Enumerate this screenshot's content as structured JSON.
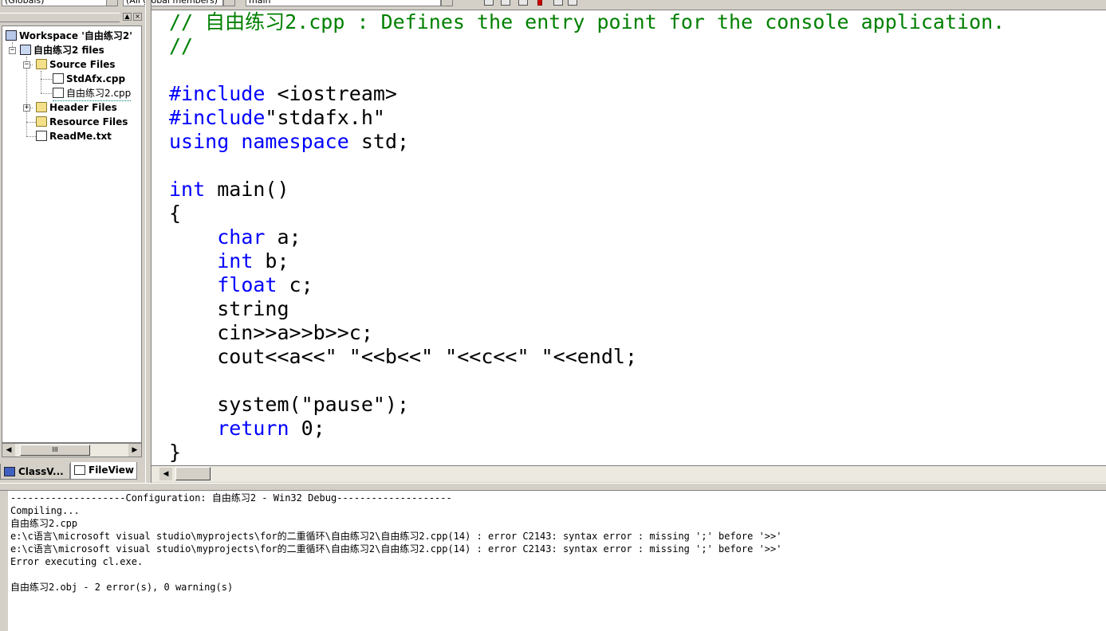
{
  "toolbar": {
    "scope_combo": "(Globals)",
    "members_combo": "(All global members)",
    "function_combo": "main"
  },
  "workspace": {
    "tree": {
      "workspace_label": "Workspace '自由练习2'",
      "project_label": "自由练习2 files",
      "source_files_label": "Source Files",
      "stdafx_label": "StdAfx.cpp",
      "main_file_label": "自由练习2.cpp",
      "header_files_label": "Header Files",
      "resource_files_label": "Resource Files",
      "readme_label": "ReadMe.txt"
    },
    "scroll_thumb_glyph": "III",
    "tabs": [
      {
        "label": "ClassV..."
      },
      {
        "label": "FileView"
      }
    ]
  },
  "editor": {
    "lines": [
      {
        "text": "// 自由练习2.cpp : Defines the entry point for the console application.",
        "kind": "comment"
      },
      {
        "text": "//",
        "kind": "comment"
      },
      {
        "text": "",
        "kind": "plain"
      },
      {
        "text": "#include <iostream>",
        "kind": "directive"
      },
      {
        "text": "#include\"stdafx.h\"",
        "kind": "directive"
      },
      {
        "text": "using namespace std;",
        "kind": "using"
      },
      {
        "text": "",
        "kind": "plain"
      },
      {
        "text": "int main()",
        "kind": "func"
      },
      {
        "text": "{",
        "kind": "plain"
      },
      {
        "text": "    char a;",
        "kind": "decl"
      },
      {
        "text": "    int b;",
        "kind": "decl"
      },
      {
        "text": "    float c;",
        "kind": "decl"
      },
      {
        "text": "    string",
        "kind": "plain"
      },
      {
        "text": "    cin>>a>>b>>c;",
        "kind": "plain"
      },
      {
        "text": "    cout<<a<<\" \"<<b<<\" \"<<c<<\" \"<<endl;",
        "kind": "plain"
      },
      {
        "text": "",
        "kind": "plain"
      },
      {
        "text": "    system(\"pause\");",
        "kind": "plain"
      },
      {
        "text": "    return 0;",
        "kind": "return"
      },
      {
        "text": "}",
        "kind": "plain"
      }
    ]
  },
  "output": {
    "lines": [
      "--------------------Configuration: 自由练习2 - Win32 Debug--------------------",
      "Compiling...",
      "自由练习2.cpp",
      "e:\\c语言\\microsoft visual studio\\myprojects\\for的二重循环\\自由练习2\\自由练习2.cpp(14) : error C2143: syntax error : missing ';' before '>>'",
      "e:\\c语言\\microsoft visual studio\\myprojects\\for的二重循环\\自由练习2\\自由练习2.cpp(14) : error C2143: syntax error : missing ';' before '>>'",
      "Error executing cl.exe.",
      "",
      "自由练习2.obj - 2 error(s), 0 warning(s)"
    ]
  },
  "colors": {
    "comment": "#008000",
    "keyword": "#0000ff",
    "window_bg": "#d4d0c8"
  }
}
